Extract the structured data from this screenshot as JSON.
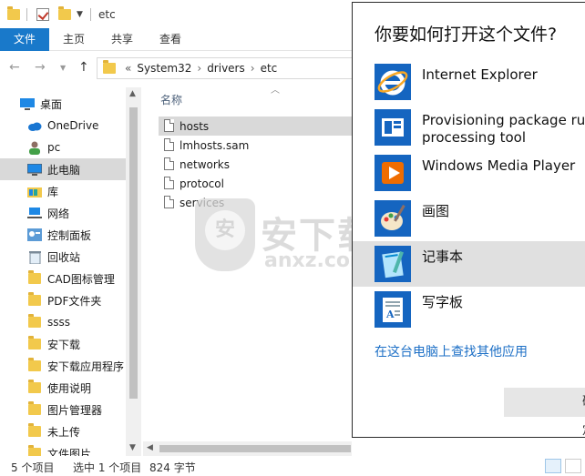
{
  "titlebar": {
    "title": "etc"
  },
  "ribbon": {
    "tabs": [
      "文件",
      "主页",
      "共享",
      "查看"
    ]
  },
  "address": {
    "overflow": "«",
    "path": [
      "System32",
      "drivers",
      "etc"
    ]
  },
  "nav": {
    "items": [
      {
        "label": "桌面",
        "icon": "desktop-icon"
      },
      {
        "label": "OneDrive",
        "icon": "cloud-icon"
      },
      {
        "label": "pc",
        "icon": "user-icon"
      },
      {
        "label": "此电脑",
        "icon": "computer-icon",
        "selected": true
      },
      {
        "label": "库",
        "icon": "library-icon"
      },
      {
        "label": "网络",
        "icon": "network-icon"
      },
      {
        "label": "控制面板",
        "icon": "control-panel-icon"
      },
      {
        "label": "回收站",
        "icon": "recycle-bin-icon"
      },
      {
        "label": "CAD图标管理",
        "icon": "folder-icon"
      },
      {
        "label": "PDF文件夹",
        "icon": "folder-icon"
      },
      {
        "label": "ssss",
        "icon": "folder-icon"
      },
      {
        "label": "安下载",
        "icon": "folder-icon"
      },
      {
        "label": "安下载应用程序",
        "icon": "folder-icon"
      },
      {
        "label": "使用说明",
        "icon": "folder-icon"
      },
      {
        "label": "图片管理器",
        "icon": "folder-icon"
      },
      {
        "label": "未上传",
        "icon": "folder-icon"
      },
      {
        "label": "文件图片",
        "icon": "folder-icon"
      }
    ]
  },
  "filelist": {
    "column_name": "名称",
    "files": [
      {
        "name": "hosts",
        "selected": true
      },
      {
        "name": "lmhosts.sam"
      },
      {
        "name": "networks"
      },
      {
        "name": "protocol"
      },
      {
        "name": "services"
      }
    ]
  },
  "status": {
    "count": "5 个项目",
    "selected": "选中 1 个项目",
    "size": "824 字节"
  },
  "watermark": {
    "text": "安下载",
    "url": "anxz.com",
    "badge": "安"
  },
  "dialog": {
    "title": "你要如何打开这个文件?",
    "apps": [
      {
        "name": "Internet Explorer",
        "icon": "internet-explorer-icon"
      },
      {
        "name": "Provisioning package runtime processing tool",
        "name_line1": "Provisioning package runtime",
        "name_line2": "processing tool",
        "icon": "provisioning-icon"
      },
      {
        "name": "Windows Media Player",
        "icon": "media-player-icon"
      },
      {
        "name": "画图",
        "icon": "paint-icon"
      },
      {
        "name": "记事本",
        "icon": "notepad-icon",
        "selected": true
      },
      {
        "name": "写字板",
        "icon": "wordpad-icon"
      }
    ],
    "more_apps_link": "在这台电脑上查找其他应用",
    "ok_button": "确定"
  },
  "colors": {
    "accent": "#1979ca",
    "selection": "#d9d9d9",
    "link": "#1c6fc6",
    "folder": "#f2c94c"
  }
}
